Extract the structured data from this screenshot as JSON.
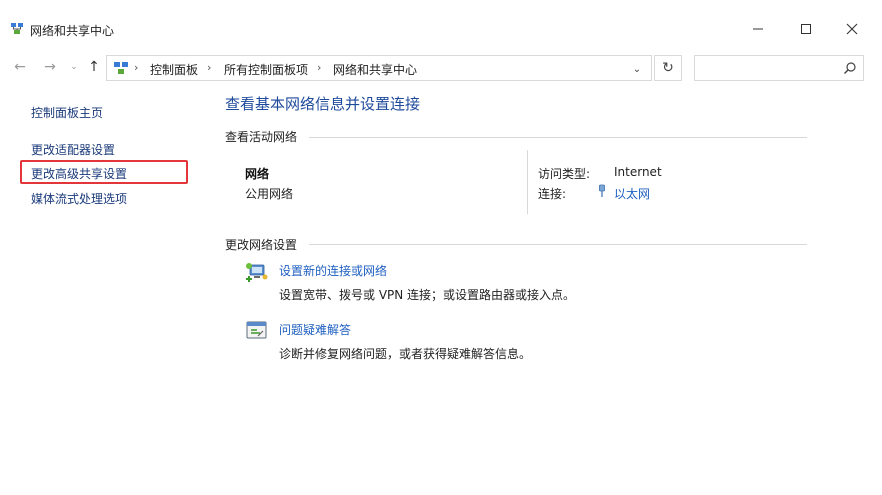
{
  "window": {
    "title": "网络和共享中心"
  },
  "address_bar": {
    "crumbs": [
      "控制面板",
      "所有控制面板项",
      "网络和共享中心"
    ],
    "search_placeholder": ""
  },
  "left_pane": {
    "items": [
      {
        "label": "控制面板主页"
      },
      {
        "label": "更改适配器设置"
      },
      {
        "label": "更改高级共享设置",
        "highlighted": true
      },
      {
        "label": "媒体流式处理选项"
      }
    ]
  },
  "main": {
    "title": "查看基本网络信息并设置连接",
    "active_networks": {
      "section_title": "查看活动网络",
      "network_name": "网络",
      "network_type": "公用网络",
      "access_type_label": "访问类型:",
      "access_type_value": "Internet",
      "connections_label": "连接:",
      "connections_value": "以太网"
    },
    "change_settings": {
      "section_title": "更改网络设置",
      "tasks": [
        {
          "link": "设置新的连接或网络",
          "description": "设置宽带、拨号或 VPN 连接；或设置路由器或接入点。",
          "icon": "new-connection-icon"
        },
        {
          "link": "问题疑难解答",
          "description": "诊断并修复网络问题，或者获得疑难解答信息。",
          "icon": "troubleshoot-icon"
        }
      ]
    }
  },
  "colors": {
    "link": "#1e5fc0",
    "title": "#1e4a9c",
    "highlight": "#e2363a"
  }
}
